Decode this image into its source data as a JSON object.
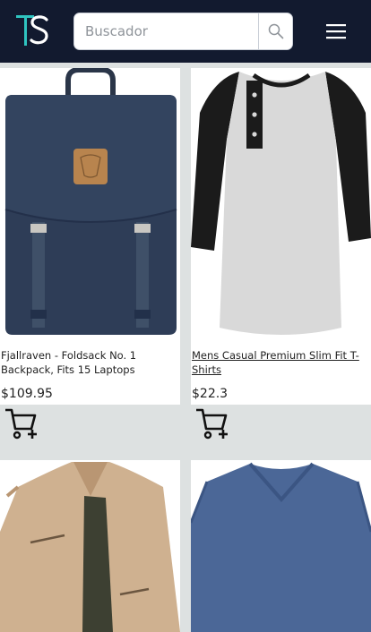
{
  "header": {
    "logo_text": "TS",
    "search_placeholder": "Buscador",
    "search_value": ""
  },
  "products": [
    {
      "title": "Fjallraven - Foldsack No. 1 Backpack, Fits 15 Laptops",
      "price": "$109.95",
      "cart_icon": "add-to-cart-icon"
    },
    {
      "title": "Mens Casual Premium Slim Fit T-Shirts",
      "price": "$22.3",
      "cart_icon": "add-to-cart-icon"
    },
    {
      "title": "",
      "price": "",
      "cart_icon": ""
    },
    {
      "title": "",
      "price": "",
      "cart_icon": ""
    }
  ],
  "colors": {
    "header_bg": "#121a2f",
    "logo_accent": "#2fc4c0",
    "page_bg": "#dde1e1"
  }
}
